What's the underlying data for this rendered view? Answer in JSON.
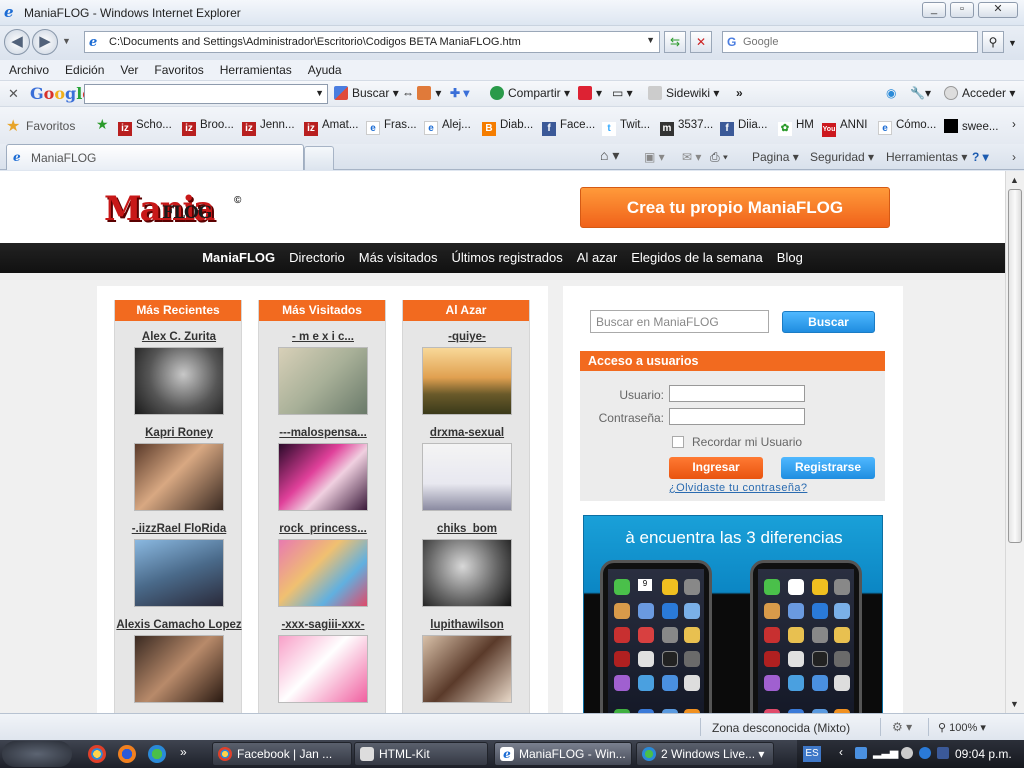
{
  "window": {
    "title": "ManiaFLOG - Windows Internet Explorer",
    "address": "C:\\Documents and Settings\\Administrador\\Escritorio\\Codigos BETA ManiaFLOG.htm",
    "search_placeholder": "Google"
  },
  "menu": [
    "Archivo",
    "Edición",
    "Ver",
    "Favoritos",
    "Herramientas",
    "Ayuda"
  ],
  "google_toolbar": {
    "logo": "Google",
    "buscar": "Buscar",
    "compartir": "Compartir",
    "sidewiki": "Sidewiki",
    "more": "»",
    "acceder": "Acceder"
  },
  "favorites": {
    "label": "Favoritos",
    "items": [
      "Scho...",
      "Broo...",
      "Jenn...",
      "Amat...",
      "Fras...",
      "Alej...",
      "Diab...",
      "Face...",
      "Twit...",
      "3537...",
      "Diia...",
      "HM",
      "ANNI",
      "Cómo...",
      "swee..."
    ]
  },
  "tab": {
    "title": "ManiaFLOG"
  },
  "commandbar": {
    "pagina": "Pagina",
    "seguridad": "Seguridad",
    "herramientas": "Herramientas"
  },
  "site": {
    "logo_main": "Mania",
    "logo_sub": "FLOG",
    "logo_reg": "©",
    "create_button": "Crea tu propio ManiaFLOG",
    "nav": [
      "ManiaFLOG",
      "Directorio",
      "Más visitados",
      "Últimos registrados",
      "Al azar",
      "Elegidos de la semana",
      "Blog"
    ],
    "columns": [
      {
        "title": "Más Recientes",
        "users": [
          "Alex C. Zurita",
          "Kapri Roney",
          "-.iizzRael FloRida",
          "Alexis Camacho Lopez"
        ]
      },
      {
        "title": "Más Visitados",
        "users": [
          "-  m e x i c...",
          "---malospensa...",
          "rock_princess...",
          "-xxx-sagiii-xxx-"
        ]
      },
      {
        "title": "Al Azar",
        "users": [
          "-quiye-",
          "drxma-sexual",
          "chiks_bom",
          "lupithawilson"
        ]
      }
    ],
    "search": {
      "placeholder": "Buscar en ManiaFLOG",
      "button": "Buscar"
    },
    "login": {
      "title": "Acceso a usuarios",
      "user_label": "Usuario:",
      "password_label": "Contraseña:",
      "remember": "Recordar mi Usuario",
      "login_button": "Ingresar",
      "register_button": "Registrarse",
      "forgot": "¿Olvidaste tu contraseña?"
    },
    "ad": {
      "text": "à encuentra las 3 diferencias",
      "clock": "9"
    }
  },
  "statusbar": {
    "zone": "Zona desconocida (Mixto)",
    "zoom": "100%"
  },
  "taskbar": {
    "buttons": [
      "Facebook | Jan ...",
      "HTML-Kit",
      "ManiaFLOG - Win...",
      "2 Windows Live..."
    ],
    "lang": "ES",
    "time": "09:04 p.m."
  }
}
